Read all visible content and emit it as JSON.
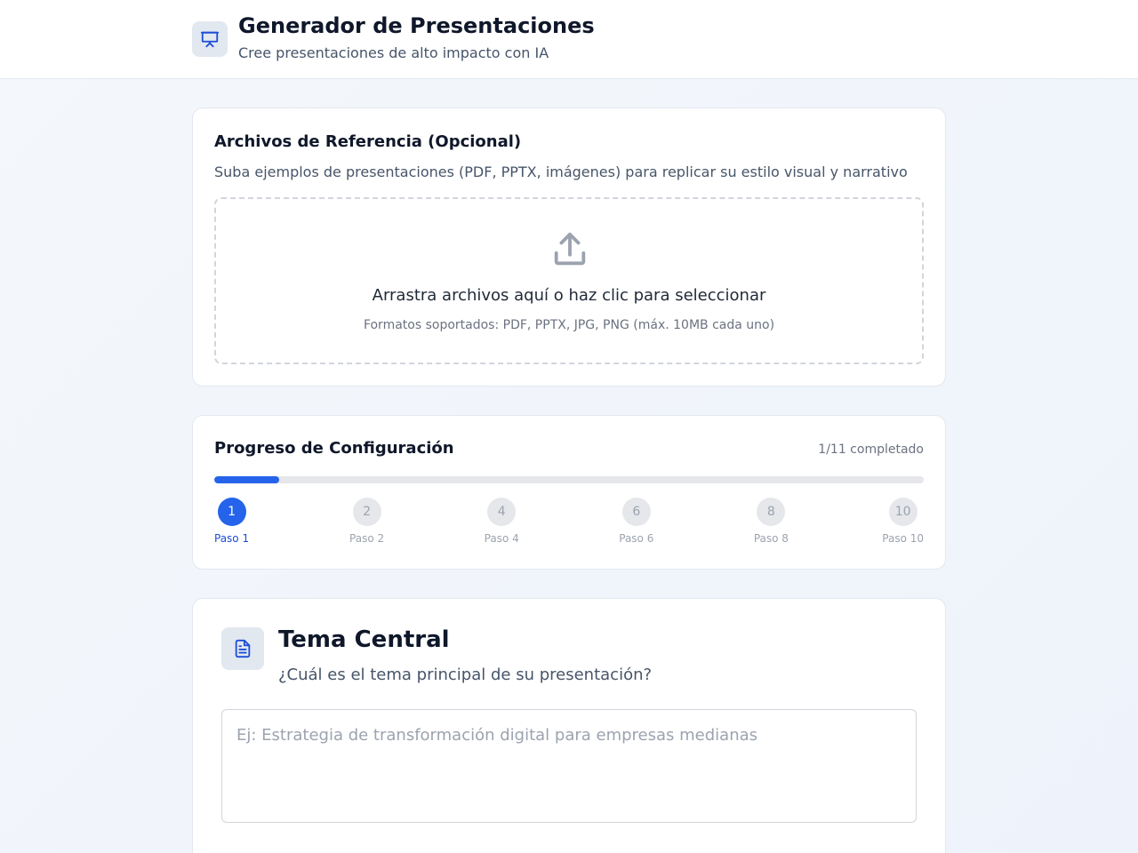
{
  "header": {
    "title": "Generador de Presentaciones",
    "subtitle": "Cree presentaciones de alto impacto con IA",
    "icon": "presentation-icon"
  },
  "upload": {
    "title": "Archivos de Referencia (Opcional)",
    "description": "Suba ejemplos de presentaciones (PDF, PPTX, imágenes) para replicar su estilo visual y narrativo",
    "dropzone_text": "Arrastra archivos aquí o haz clic para seleccionar",
    "formats_text": "Formatos soportados: PDF, PPTX, JPG, PNG (máx. 10MB cada uno)",
    "icon": "upload-icon"
  },
  "progress": {
    "title": "Progreso de Configuración",
    "count_text": "1/11 completado",
    "completed": 1,
    "total": 11,
    "steps": [
      {
        "number": "1",
        "label": "Paso 1",
        "active": true
      },
      {
        "number": "2",
        "label": "Paso 2",
        "active": false
      },
      {
        "number": "4",
        "label": "Paso 4",
        "active": false
      },
      {
        "number": "6",
        "label": "Paso 6",
        "active": false
      },
      {
        "number": "8",
        "label": "Paso 8",
        "active": false
      },
      {
        "number": "10",
        "label": "Paso 10",
        "active": false
      }
    ]
  },
  "topic": {
    "title": "Tema Central",
    "question": "¿Cuál es el tema principal de su presentación?",
    "input_value": "",
    "input_placeholder": "Ej: Estrategia de transformación digital para empresas medianas",
    "icon": "document-icon"
  },
  "colors": {
    "accent": "#2563eb",
    "accent_dark": "#1d4ed8",
    "muted": "#9ca3af"
  }
}
